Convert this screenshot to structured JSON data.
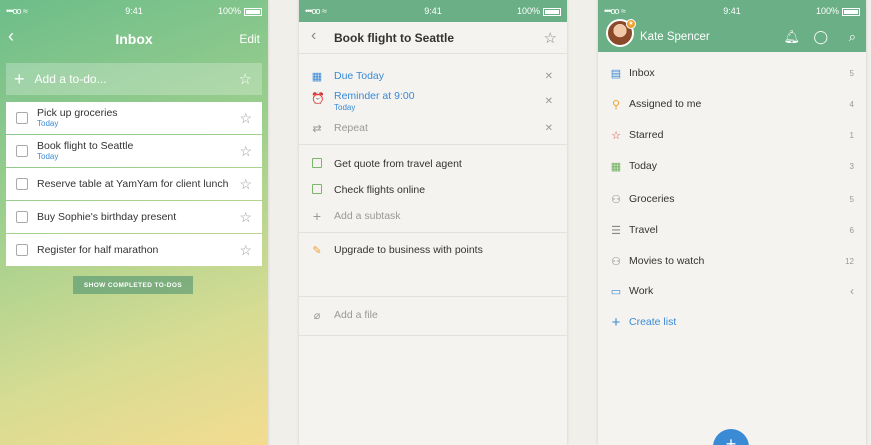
{
  "status": {
    "carrier": "•••oo",
    "wifi": "≈",
    "time": "9:41",
    "battery": "100%"
  },
  "inbox": {
    "back": "‹",
    "title": "Inbox",
    "edit": "Edit",
    "add_placeholder": "Add a to-do...",
    "todos": [
      {
        "title": "Pick up groceries",
        "due": "Today"
      },
      {
        "title": "Book flight to Seattle",
        "due": "Today"
      },
      {
        "title": "Reserve table at YamYam for client lunch",
        "due": ""
      },
      {
        "title": "Buy Sophie's birthday present",
        "due": ""
      },
      {
        "title": "Register for half marathon",
        "due": ""
      }
    ],
    "show_completed": "SHOW COMPLETED TO-DOS"
  },
  "detail": {
    "back": "‹",
    "title": "Book flight to Seattle",
    "due_label": "Due Today",
    "reminder_label": "Reminder at 9:00",
    "reminder_sub": "Today",
    "repeat_label": "Repeat",
    "subtasks": [
      "Get quote from travel agent",
      "Check flights online"
    ],
    "add_subtask": "Add a subtask",
    "note": "Upgrade to business with points",
    "add_file": "Add a file"
  },
  "lists": {
    "user": "Kate Spencer",
    "badge": "★",
    "items": [
      {
        "label": "Inbox",
        "count": "5",
        "icon": "inbox-icon",
        "color": "#3a8ad6"
      },
      {
        "label": "Assigned to me",
        "count": "4",
        "icon": "person-icon",
        "color": "#f0a030"
      },
      {
        "label": "Starred",
        "count": "1",
        "icon": "star-icon",
        "color": "#e0463a"
      },
      {
        "label": "Today",
        "count": "3",
        "icon": "calendar-icon",
        "color": "#6aaf5a"
      },
      {
        "label": "Groceries",
        "count": "5",
        "icon": "people-icon",
        "color": "#888888"
      },
      {
        "label": "Travel",
        "count": "6",
        "icon": "list-icon",
        "color": "#888888"
      },
      {
        "label": "Movies to watch",
        "count": "12",
        "icon": "people-icon",
        "color": "#888888"
      },
      {
        "label": "Work",
        "count": "‹",
        "icon": "folder-icon",
        "color": "#3a8ad6"
      }
    ],
    "create_list": "Create list",
    "fab": "+"
  }
}
